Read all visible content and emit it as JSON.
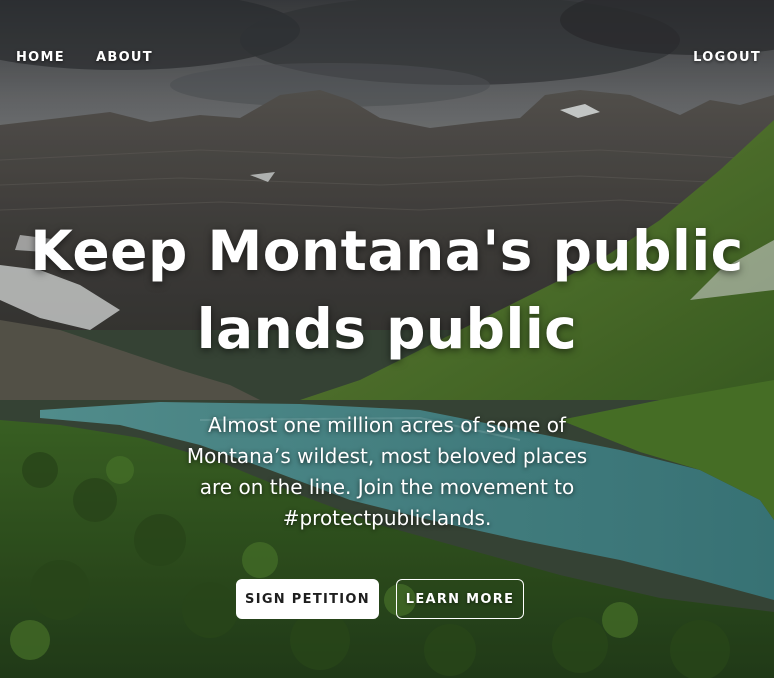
{
  "nav": {
    "home_label": "HOME",
    "about_label": "ABOUT",
    "logout_label": "LOGOUT"
  },
  "hero": {
    "headline_line1": "Keep Montana's public",
    "headline_line2": "lands public",
    "subtext_line1": "Almost one million acres of some of",
    "subtext_line2": "Montana’s wildest, most beloved places",
    "subtext_line3": "are on the line. Join the movement to",
    "subtext_line4": "#protectpubliclands.",
    "background_image": "mountain-lake-valley"
  },
  "actions": {
    "sign_petition_label": "SIGN PETITION",
    "learn_more_label": "LEARN MORE"
  },
  "colors": {
    "text": "#ffffff",
    "primary_button_bg": "#ffffff",
    "primary_button_text": "#1e1e1e",
    "sky": "#6b6d6f",
    "rock": "#4a4845",
    "meadow": "#4f7a2c",
    "lake": "#4d8f8e"
  }
}
